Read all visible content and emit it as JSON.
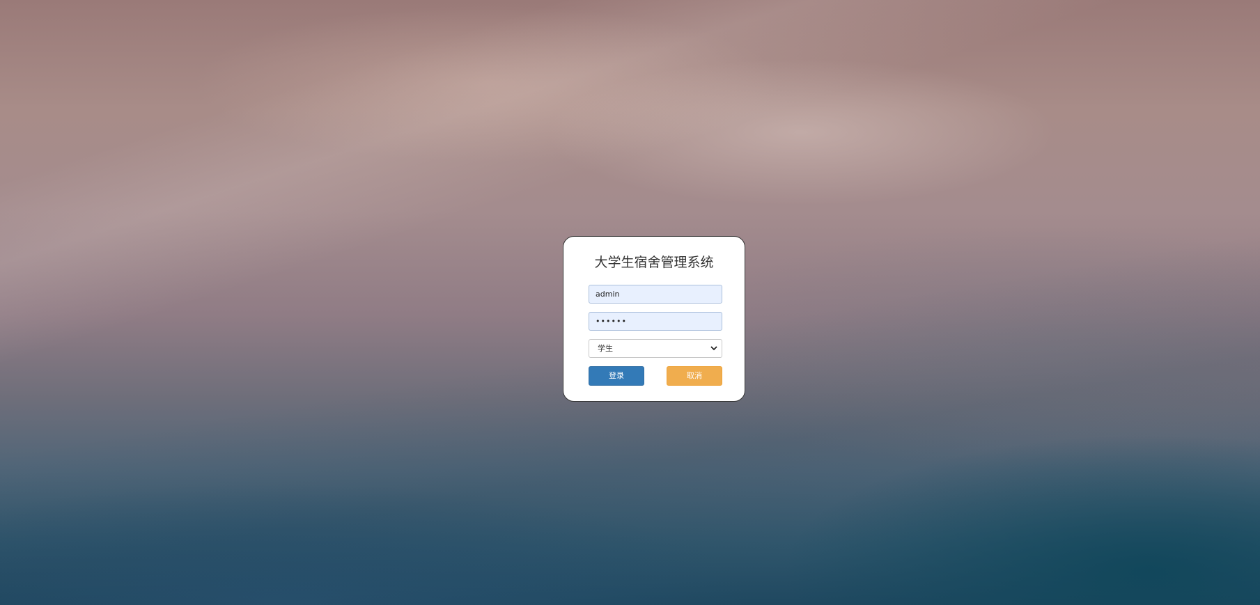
{
  "login": {
    "title": "大学生宿舍管理系统",
    "username_value": "admin",
    "password_value": "••••••",
    "role_selected": "学生",
    "login_label": "登录",
    "cancel_label": "取消"
  },
  "colors": {
    "login_button": "#337ab7",
    "cancel_button": "#f0ad4e",
    "autofill_field": "#e8f0fe"
  },
  "icons": {
    "select_arrow": "chevron-down-icon"
  }
}
